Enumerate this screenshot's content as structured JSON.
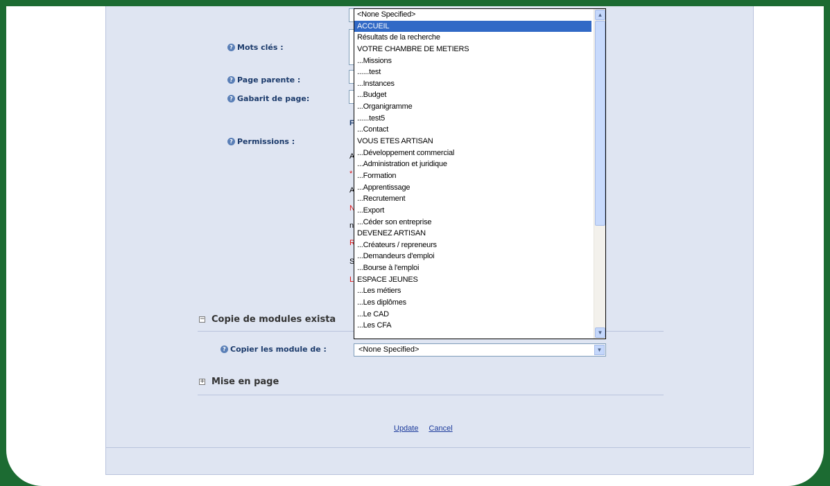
{
  "labels": {
    "keywords": "Mots clés :",
    "parent_page": "Page parente :",
    "page_template": "Gabarit de page:",
    "permissions": "Permissions :",
    "copy_from": "Copier les module de :"
  },
  "sections": {
    "copy_modules": "Copie de modules exista",
    "layout": "Mise en page"
  },
  "permission_fragments": [
    "F",
    "A",
    "*",
    "A",
    "N",
    "n",
    "R",
    "S",
    "L"
  ],
  "select_copy_from": {
    "value": "<None Specified>"
  },
  "dropdown_options": [
    "<None Specified>",
    "ACCUEIL",
    "Résultats de la recherche",
    "VOTRE CHAMBRE DE METIERS",
    "...Missions",
    "......test",
    "...Instances",
    "...Budget",
    "...Organigramme",
    "......test5",
    "...Contact",
    "VOUS ETES ARTISAN",
    "...Développement commercial",
    "...Administration et juridique",
    "...Formation",
    "...Apprentissage",
    "...Recrutement",
    "...Export",
    "...Céder son entreprise",
    "DEVENEZ ARTISAN",
    "...Créateurs / repreneurs",
    "...Demandeurs d'emploi",
    "...Bourse à l'emploi",
    "ESPACE JEUNES",
    "...Les métiers",
    "...Les diplômes",
    "...Le CAD",
    "...Les CFA"
  ],
  "selected_option": "ACCUEIL",
  "actions": {
    "update": "Update",
    "cancel": "Cancel"
  },
  "icons": {
    "help": "help-icon",
    "collapse": "minus-box-icon",
    "expand": "plus-box-icon",
    "scroll_up": "arrow-up-icon",
    "scroll_down": "arrow-down-icon"
  }
}
